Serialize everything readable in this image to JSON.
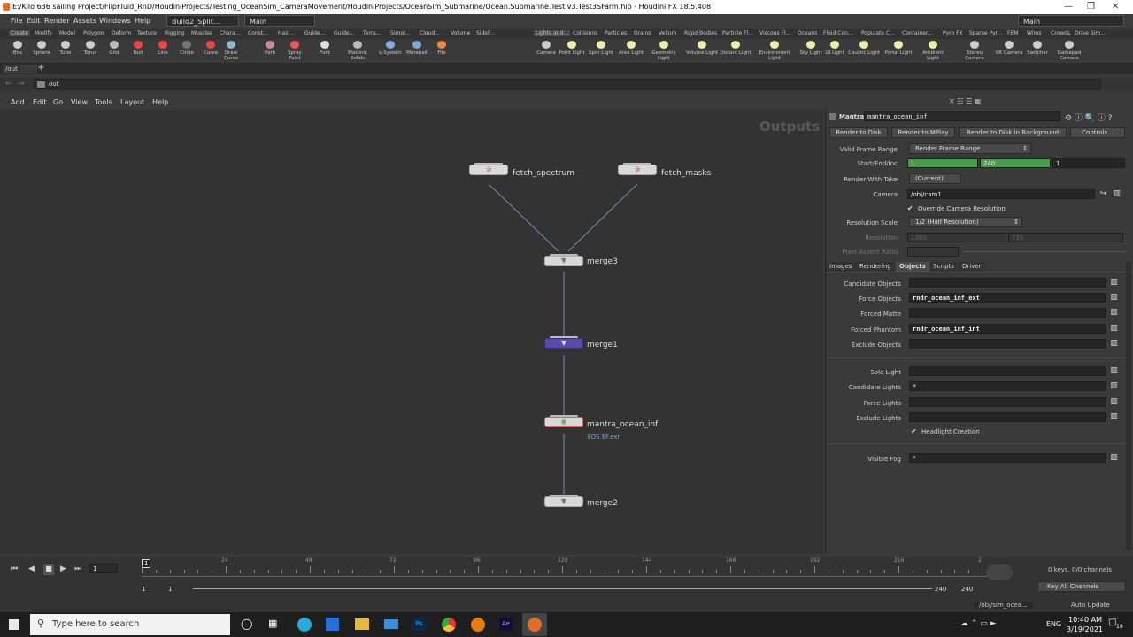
{
  "window": {
    "title": "E:/Kilo 636 sailing Project/FlipFluid_RnD/HoudiniProjects/Testing_OceanSim_CameraMovement/HoudiniProjects/OceanSim_Submarine/Ocean.Submarine.Test.v3.Test3SFarm.hip - Houdini FX 18.5.408"
  },
  "menubar": {
    "items": [
      "File",
      "Edit",
      "Render",
      "Assets",
      "Windows",
      "Help"
    ],
    "desktop": "Build2_Split...",
    "workspace": "Main",
    "desktop_right": "Main"
  },
  "shelf": {
    "tabs": [
      "Create",
      "Modify",
      "Model",
      "Polygon",
      "Deform",
      "Texture",
      "Rigging",
      "Muscles",
      "Chara...",
      "Const...",
      "Hair...",
      "Guide...",
      "Guide...",
      "Terra...",
      "Simpl...",
      "Cloud...",
      "Volume",
      "SideF..."
    ],
    "tabs_right": [
      "Lights and...",
      "Collisions",
      "Particles",
      "Grains",
      "Vellum",
      "Rigid Bodies",
      "Particle Fl...",
      "Viscous Fl...",
      "Oceans",
      "Fluid Con...",
      "Populate C...",
      "Container...",
      "Pyro FX",
      "Sparse Pyr...",
      "FEM",
      "Wires",
      "Crowds",
      "Drive Sim..."
    ],
    "tools": [
      "Box",
      "Sphere",
      "Tube",
      "Torus",
      "Grid",
      "Null",
      "Line",
      "Circle",
      "Curve",
      "Draw Curve",
      "Path",
      "Spray Paint",
      "Font",
      "Platonic Solids",
      "L-System",
      "Metaball",
      "File"
    ],
    "tools_right": [
      "Camera",
      "Point Light",
      "Spot Light",
      "Area Light",
      "Geometry Light",
      "Volume Light",
      "Distant Light",
      "Environment Light",
      "Sky Light",
      "GI Light",
      "Caustic Light",
      "Portal Light",
      "Ambient Light",
      "Stereo Camera",
      "VR Camera",
      "Switcher",
      "Gamepad Camera"
    ]
  },
  "panetab": {
    "label": "/out"
  },
  "pathbar": {
    "path": "out"
  },
  "network_menu": [
    "Add",
    "Edit",
    "Go",
    "View",
    "Tools",
    "Layout",
    "Help"
  ],
  "network": {
    "context_label": "Outputs",
    "nodes": [
      {
        "name": "fetch_spectrum"
      },
      {
        "name": "fetch_masks"
      },
      {
        "name": "merge3"
      },
      {
        "name": "merge1"
      },
      {
        "name": "mantra_ocean_inf",
        "sub": "$OS.$F.exr"
      },
      {
        "name": "merge2"
      }
    ]
  },
  "params": {
    "node_type": "Mantra",
    "node_name": "mantra_ocean_inf",
    "buttons": [
      "Render to Disk",
      "Render to MPlay",
      "Render to Disk in Background",
      "Controls..."
    ],
    "valid_frame_range_label": "Valid Frame Range",
    "valid_frame_range": "Render Frame Range",
    "start_end_inc_label": "Start/End/Inc",
    "start": "1",
    "end": "240",
    "inc": "1",
    "render_with_take_label": "Render With Take",
    "render_with_take": "(Current)",
    "camera_label": "Camera",
    "camera": "/obj/cam1",
    "override_res": "Override Camera Resolution",
    "res_scale_label": "Resolution Scale",
    "res_scale": "1/2 (Half Resolution)",
    "resolution_label": "Resolution",
    "res_x": "1280",
    "res_y": "720",
    "pixel_aspect_label": "Pixel Aspect Ratio",
    "tabs": [
      "Images",
      "Rendering",
      "Objects",
      "Scripts",
      "Driver"
    ],
    "candidate_objects_label": "Candidate Objects",
    "candidate_objects": "",
    "force_objects_label": "Force Objects",
    "force_objects": "rndr_ocean_inf_ext",
    "forced_matte_label": "Forced Matte",
    "forced_matte": "",
    "forced_phantom_label": "Forced Phantom",
    "forced_phantom": "rndr_ocean_inf_int",
    "exclude_objects_label": "Exclude Objects",
    "exclude_objects": "",
    "solo_light_label": "Solo Light",
    "solo_light": "",
    "candidate_lights_label": "Candidate Lights",
    "candidate_lights": "*",
    "force_lights_label": "Force Lights",
    "force_lights": "",
    "exclude_lights_label": "Exclude Lights",
    "exclude_lights": "",
    "headlight_creation": "Headlight Creation",
    "visible_fog_label": "Visible Fog",
    "visible_fog": "*"
  },
  "timeline": {
    "current_frame": "1",
    "marker": "1",
    "ticks": [
      "24",
      "48",
      "72",
      "96",
      "120",
      "144",
      "168",
      "192",
      "216",
      "2"
    ],
    "range_start": "1",
    "range_start2": "1",
    "range_end": "240",
    "range_end2": "240",
    "keys_info": "0 keys, 0/0 channels",
    "key_all": "Key All Channels",
    "scene_path": "/obj/sim_ocea...",
    "auto_update": "Auto Update"
  },
  "taskbar": {
    "search_placeholder": "Type here to search",
    "lang": "ENG",
    "time": "10:40 AM",
    "date": "3/19/2021",
    "notif_count": "19"
  }
}
